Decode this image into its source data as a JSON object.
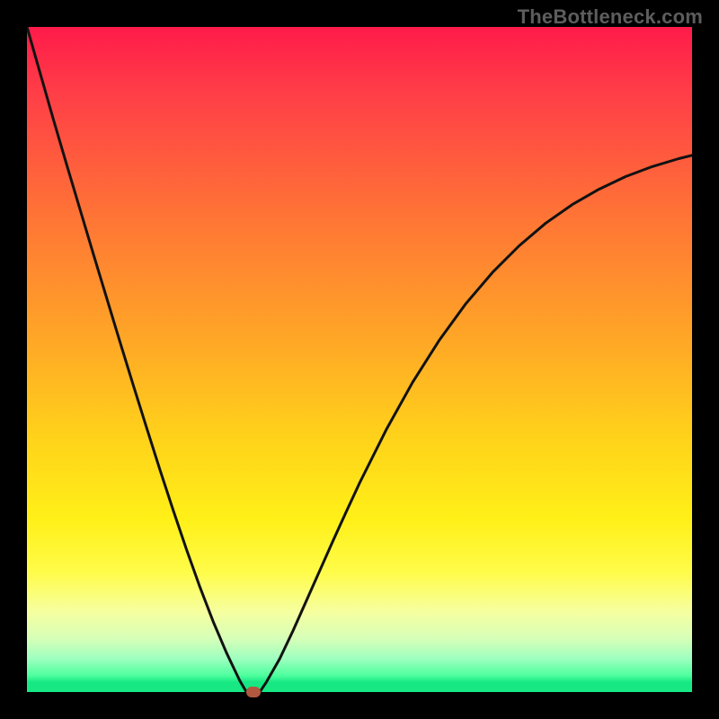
{
  "watermark": "TheBottleneck.com",
  "colors": {
    "frame_bg": "#000000",
    "curve_stroke": "#121212",
    "marker_fill": "#b0593f",
    "gradient_top": "#ff1b4a",
    "gradient_bottom": "#17e884"
  },
  "chart_data": {
    "type": "line",
    "title": "",
    "xlabel": "",
    "ylabel": "",
    "xlim": [
      0,
      100
    ],
    "ylim": [
      0,
      100
    ],
    "x": [
      0,
      2,
      4,
      6,
      8,
      10,
      12,
      14,
      16,
      18,
      20,
      22,
      24,
      26,
      28,
      30,
      31,
      32,
      33,
      34,
      35,
      36,
      38,
      40,
      42,
      44,
      46,
      48,
      50,
      54,
      58,
      62,
      66,
      70,
      74,
      78,
      82,
      86,
      90,
      94,
      98,
      100
    ],
    "values": [
      100,
      93,
      86,
      79.2,
      72.5,
      65.8,
      59.2,
      52.6,
      46.1,
      39.7,
      33.4,
      27.3,
      21.4,
      15.8,
      10.6,
      5.9,
      3.8,
      1.7,
      0,
      0,
      0,
      1.5,
      5.0,
      9.2,
      13.7,
      18.2,
      22.7,
      27.1,
      31.4,
      39.4,
      46.6,
      52.9,
      58.4,
      63.1,
      67.1,
      70.5,
      73.3,
      75.6,
      77.5,
      79.0,
      80.2,
      80.7
    ],
    "marker": {
      "x": 34.0,
      "y": 0
    },
    "notes": "Values are read off the image as percentage of plot height from the bottom (0 = bottom edge, 100 = top edge). Axes and tick labels are not displayed in the source image."
  }
}
